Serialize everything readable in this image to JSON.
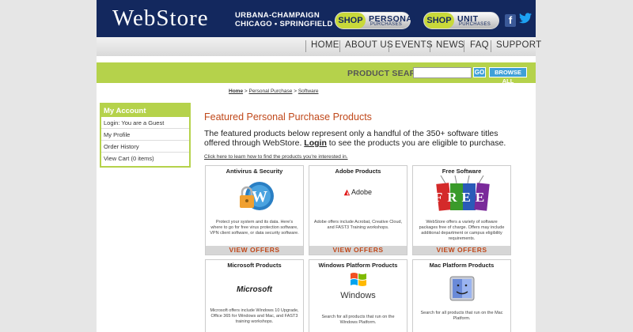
{
  "header": {
    "logo": "WebStore",
    "campus_line1": "URBANA-CHAMPAIGN",
    "campus_line2": "CHICAGO • SPRINGFIELD",
    "shop_personal": {
      "shop": "SHOP",
      "title": "PERSONAL",
      "sub": "PURCHASES"
    },
    "shop_unit": {
      "shop": "SHOP",
      "title": "UNIT",
      "sub": "PURCHASES"
    },
    "facebook": "f",
    "twitter_icon": "twitter-bird"
  },
  "nav": [
    "HOME",
    "ABOUT US",
    "EVENTS",
    "NEWS",
    "FAQ",
    "SUPPORT"
  ],
  "search": {
    "label": "PRODUCT SEARCH:",
    "value": "",
    "go": "GO",
    "browse": "BROWSE ALL"
  },
  "breadcrumb": {
    "home": "Home",
    "sep": " > ",
    "level1": "Personal Purchase",
    "level2": "Software"
  },
  "account": {
    "title": "My Account",
    "items": [
      "Login: You are a Guest",
      "My Profile",
      "Order History",
      "View Cart (0 items)"
    ]
  },
  "main": {
    "title": "Featured Personal Purchase Products",
    "intro_pre": "The featured products below represent only a handful of the 350+ software titles offered through WebStore. ",
    "intro_link": "Login",
    "intro_post": " to see the products you are eligible to purchase.",
    "help_link": "Click here to learn how to find the products you're interested in."
  },
  "cards": [
    {
      "title": "Antivirus & Security",
      "icon": "lock-icon",
      "desc": "Protect your system and its data. Here's where to go for free virus protection software, VPN client software, or data security software.",
      "cta": "VIEW OFFERS"
    },
    {
      "title": "Adobe Products",
      "logo_text": "Adobe",
      "icon": "adobe-logo",
      "desc": "Adobe offers include Acrobat, Creative Cloud, and FAST3 Training workshops.",
      "cta": "VIEW OFFERS"
    },
    {
      "title": "Free Software",
      "logo_text": "FREE",
      "icon": "free-tags",
      "desc": "WebStore offers a variety of software packages free of charge. Offers may include additional department or campus eligibility requirements.",
      "cta": "VIEW OFFERS"
    },
    {
      "title": "Microsoft Products",
      "logo_text": "Microsoft",
      "icon": "microsoft-logo",
      "desc": "Microsoft offers include Windows 10 Upgrade, Office 365 for Windows and Mac, and FAST3 training workshops."
    },
    {
      "title": "Windows Platform Products",
      "logo_text": "Windows",
      "icon": "windows-logo",
      "desc": "Search for all products that run on the Windows Platform."
    },
    {
      "title": "Mac Platform Products",
      "icon": "mac-finder-icon",
      "desc": "Search for all products that run on the Mac Platform."
    }
  ],
  "colors": {
    "navy": "#13285e",
    "green": "#b5d24b",
    "orange": "#c0481a",
    "blue": "#3fa0d8"
  }
}
